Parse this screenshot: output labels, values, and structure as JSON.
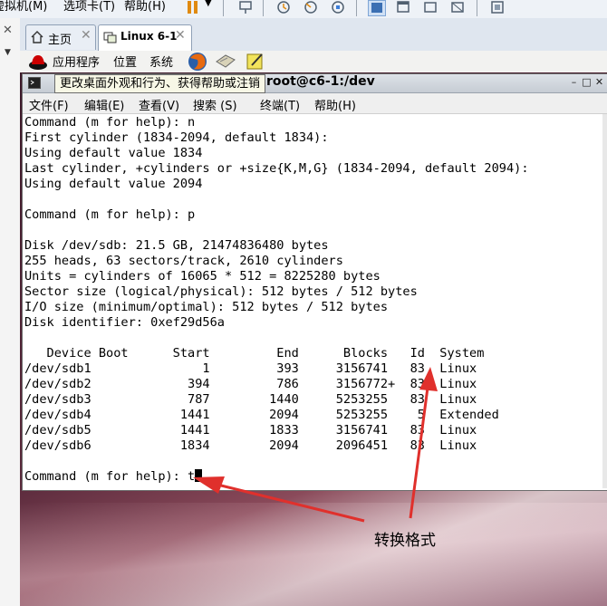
{
  "host_menu": {
    "vm": "虚拟机(M)",
    "tabs_menu": "选项卡(T)",
    "help": "帮助(H)"
  },
  "tabs": [
    {
      "label": "主页"
    },
    {
      "label": "Linux 6-1"
    }
  ],
  "gnome_panel": {
    "apps": "应用程序",
    "places": "位置",
    "system": "系统"
  },
  "terminal": {
    "title": "root@c6-1:/dev",
    "menu": [
      "文件(F)",
      "编辑(E)",
      "查看(V)",
      "搜索 (S)",
      "终端(T)",
      "帮助(H)"
    ],
    "tooltip": "更改桌面外观和行为、获得帮助或注销",
    "lines": [
      "Command (m for help): n",
      "First cylinder (1834-2094, default 1834):",
      "Using default value 1834",
      "Last cylinder, +cylinders or +size{K,M,G} (1834-2094, default 2094):",
      "Using default value 2094",
      "",
      "Command (m for help): p",
      "",
      "Disk /dev/sdb: 21.5 GB, 21474836480 bytes",
      "255 heads, 63 sectors/track, 2610 cylinders",
      "Units = cylinders of 16065 * 512 = 8225280 bytes",
      "Sector size (logical/physical): 512 bytes / 512 bytes",
      "I/O size (minimum/optimal): 512 bytes / 512 bytes",
      "Disk identifier: 0xef29d56a",
      "",
      "   Device Boot      Start         End      Blocks   Id  System",
      "/dev/sdb1               1         393     3156741   83  Linux",
      "/dev/sdb2             394         786     3156772+  83  Linux",
      "/dev/sdb3             787        1440     5253255   83  Linux",
      "/dev/sdb4            1441        2094     5253255    5  Extended",
      "/dev/sdb5            1441        1833     3156741   83  Linux",
      "/dev/sdb6            1834        2094     2096451   83  Linux",
      ""
    ],
    "prompt": "Command (m for help): t"
  },
  "annotation": "转换格式",
  "colors": {
    "arrow": "#e0302c",
    "terminal_bg": "#ffffff",
    "desktop": "#4a2233"
  }
}
